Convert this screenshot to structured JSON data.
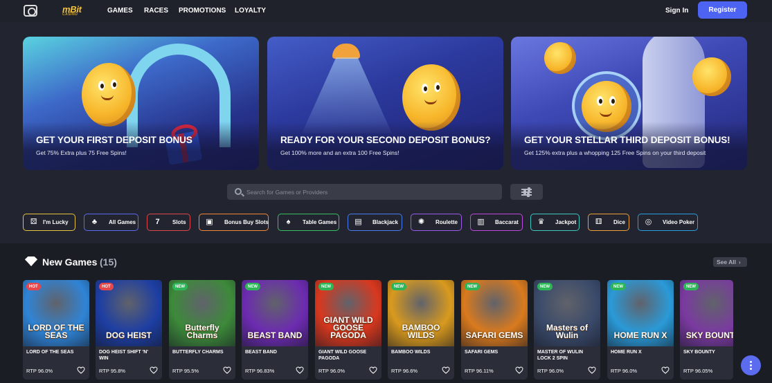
{
  "header": {
    "brand": "mBit",
    "brand_sub": "CASINO",
    "nav": [
      "GAMES",
      "RACES",
      "PROMOTIONS",
      "LOYALTY"
    ],
    "signin": "Sign In",
    "register": "Register",
    "accent": "#4d63f1"
  },
  "banners": [
    {
      "title": "GET YOUR FIRST DEPOSIT BONUS",
      "subtitle": "Get 75% Extra plus 75 Free Spins!"
    },
    {
      "title": "READY FOR YOUR SECOND DEPOSIT BONUS?",
      "subtitle": "Get 100% more and an extra 100 Free Spins!"
    },
    {
      "title": "GET YOUR STELLAR THIRD DEPOSIT BONUS!",
      "subtitle": "Get 125% extra plus a whopping 125 Free Spins on your third deposit"
    }
  ],
  "search": {
    "placeholder": "Search for Games or Providers"
  },
  "categories": [
    {
      "label": "I'm Lucky",
      "icon": "dice-icon",
      "color": "#e8c243"
    },
    {
      "label": "All Games",
      "icon": "cards-icon",
      "color": "#5b6cf0"
    },
    {
      "label": "Slots",
      "icon": "slots-icon",
      "color": "#e0474c"
    },
    {
      "label": "Bonus Buy Slots",
      "icon": "bonus-icon",
      "color": "#f08a3a"
    },
    {
      "label": "Table Games",
      "icon": "table-icon",
      "color": "#39c060"
    },
    {
      "label": "Blackjack",
      "icon": "blackjack-icon",
      "color": "#4a7df0"
    },
    {
      "label": "Roulette",
      "icon": "roulette-icon",
      "color": "#9b5cf0"
    },
    {
      "label": "Baccarat",
      "icon": "baccarat-icon",
      "color": "#c04ae0"
    },
    {
      "label": "Jackpot",
      "icon": "jackpot-icon",
      "color": "#3fc9c0"
    },
    {
      "label": "Dice",
      "icon": "dice-icon",
      "color": "#f0a23a"
    },
    {
      "label": "Video Poker",
      "icon": "chip-icon",
      "color": "#2f9ee0"
    }
  ],
  "section": {
    "title": "New Games",
    "count": "(15)",
    "see_all": "See All"
  },
  "games": [
    {
      "tag": "HOT",
      "logo": "LORD OF THE SEAS",
      "name": "LORD OF THE SEAS",
      "rtp": "RTP 96.0%",
      "bg": "#2f84d6"
    },
    {
      "tag": "HOT",
      "logo": "DOG HEIST",
      "name": "DOG HEIST SHIFT 'N' WIN",
      "rtp": "RTP 95.8%",
      "bg": "#1d3ea3"
    },
    {
      "tag": "NEW",
      "logo": "Butterfly Charms",
      "name": "BUTTERFLY CHARMS",
      "rtp": "RTP 95.5%",
      "bg": "#3d8a3a"
    },
    {
      "tag": "NEW",
      "logo": "BEAST BAND",
      "name": "BEAST BAND",
      "rtp": "RTP 96.83%",
      "bg": "#6c2bb0"
    },
    {
      "tag": "NEW",
      "logo": "GIANT WILD GOOSE PAGODA",
      "name": "GIANT WILD GOOSE PAGODA",
      "rtp": "RTP 96.0%",
      "bg": "#d8381e"
    },
    {
      "tag": "NEW",
      "logo": "BAMBOO WILDS",
      "name": "BAMBOO WILDS",
      "rtp": "RTP 96.6%",
      "bg": "#d99a1e"
    },
    {
      "tag": "NEW",
      "logo": "SAFARI GEMS",
      "name": "SAFARI GEMS",
      "rtp": "RTP 96.11%",
      "bg": "#d97a1e"
    },
    {
      "tag": "NEW",
      "logo": "Masters of Wulin",
      "name": "MASTER OF WULIN LOCK 2 SPIN",
      "rtp": "RTP 96.0%",
      "bg": "#3a4a6a"
    },
    {
      "tag": "NEW",
      "logo": "HOME RUN X",
      "name": "HOME RUN X",
      "rtp": "RTP 96.0%",
      "bg": "#2a9ad8"
    },
    {
      "tag": "NEW",
      "logo": "SKY BOUNTY",
      "name": "SKY BOUNTY",
      "rtp": "RTP 96.05%",
      "bg": "#7a3aa0"
    }
  ]
}
